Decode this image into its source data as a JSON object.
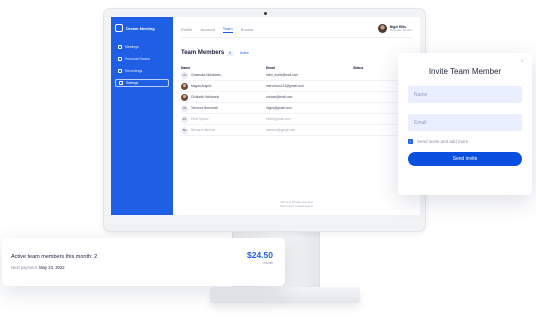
{
  "app": {
    "brand": "Dream Meeting"
  },
  "sidebar": {
    "items": [
      {
        "label": "Meetings"
      },
      {
        "label": "Personal Rooms"
      },
      {
        "label": "Recordings"
      },
      {
        "label": "Settings"
      }
    ]
  },
  "topbar": {
    "tabs": [
      {
        "label": "Profile"
      },
      {
        "label": "Account"
      },
      {
        "label": "Team"
      },
      {
        "label": "Rooms"
      }
    ],
    "user_name": "Nigel Ellis",
    "user_company": "Presenter Studios"
  },
  "team": {
    "title": "Team Members",
    "count": "6",
    "filter": "Active",
    "columns": [
      "Name",
      "Email",
      "Status"
    ],
    "members": [
      {
        "initials": "CN",
        "name": "Chiamaka Ndiokwelu",
        "email": "hello_world@mail.com"
      },
      {
        "initials": "",
        "name": "Magda Angelo",
        "email": "marvelous123@gmail.com"
      },
      {
        "initials": "",
        "name": "Chidiadiu Ndukwelu",
        "email": "contact@mail.com"
      },
      {
        "initials": "TB",
        "name": "Terrence Beermuth",
        "email": "migor@gmail.com"
      },
      {
        "initials": "ES",
        "name": "Ethel Spano",
        "email": "ethel@gmail.com"
      },
      {
        "initials": "BH",
        "name": "Bernard Harrison",
        "email": "harrison@gmail.com"
      }
    ],
    "footer_line1": "Add up to 10 team members",
    "footer_line2": "Need more? Contact support"
  },
  "modal": {
    "title": "Invite Team Member",
    "name_placeholder": "Name",
    "email_placeholder": "Email",
    "checkbox_label": "Send invite and add more",
    "send_label": "Send invite",
    "close_glyph": "×"
  },
  "billing": {
    "label": "Active team members this month: 2",
    "next_label": "Next payment:",
    "next_date": "May 23, 2022",
    "amount": "$24.50",
    "amount_sub": "/month"
  },
  "colors": {
    "accent": "#1e5fe6",
    "input_bg": "#e9efff"
  }
}
